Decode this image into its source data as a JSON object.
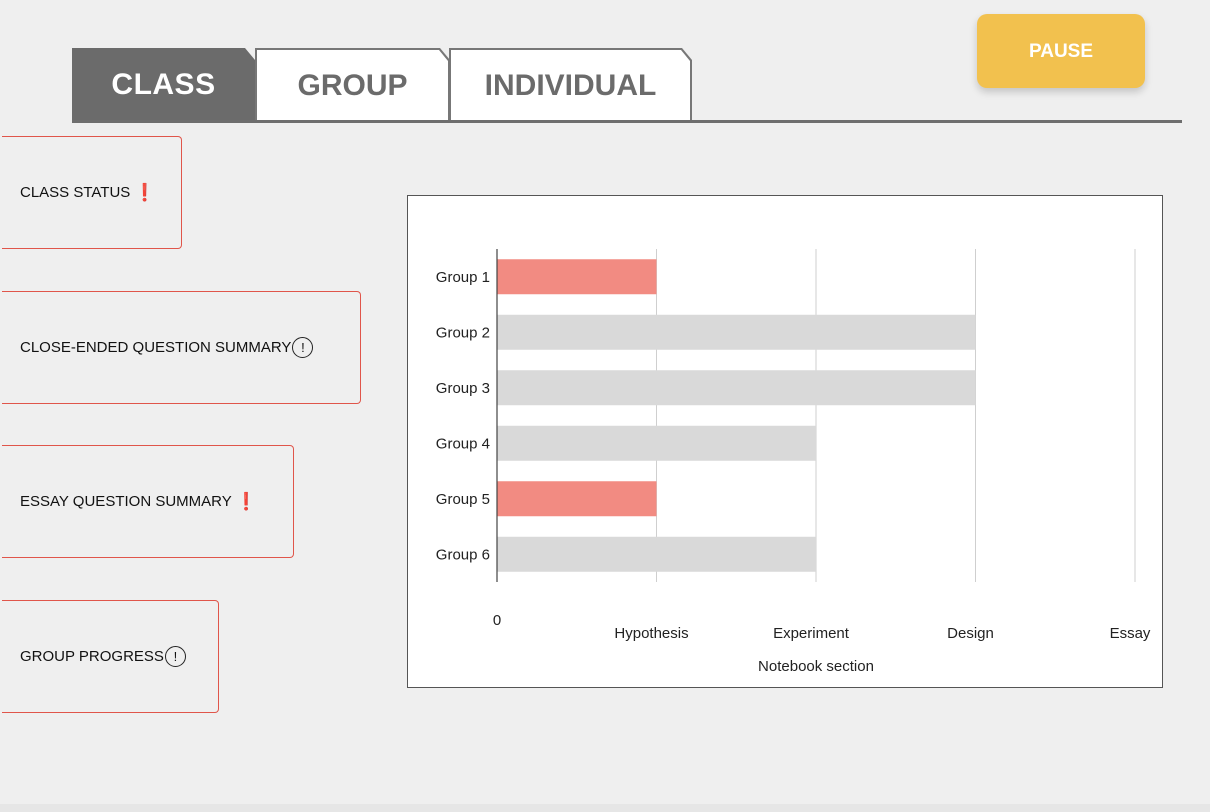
{
  "tabs": [
    {
      "label": "CLASS",
      "active": true
    },
    {
      "label": "GROUP",
      "active": false
    },
    {
      "label": "INDIVIDUAL",
      "active": false
    }
  ],
  "pause_button": {
    "label": "PAUSE",
    "color": "#f2c14e"
  },
  "panels": [
    {
      "label": "CLASS STATUS",
      "icon": "exclamation-icon",
      "icon_glyph": "❗"
    },
    {
      "label": "CLOSE-ENDED QUESTION SUMMARY",
      "icon": "circled-exclamation-icon",
      "icon_glyph": "!"
    },
    {
      "label": "ESSAY QUESTION SUMMARY",
      "icon": "exclamation-icon",
      "icon_glyph": "❗"
    },
    {
      "label": "GROUP PROGRESS",
      "icon": "circled-exclamation-icon",
      "icon_glyph": "!"
    }
  ],
  "colors": {
    "accent_alert": "#f28b82",
    "bar_default": "#d9d9d9",
    "panel_border": "#e0554a"
  },
  "chart_data": {
    "type": "bar",
    "orientation": "horizontal",
    "categories": [
      "Group 1",
      "Group 2",
      "Group 3",
      "Group 4",
      "Group 5",
      "Group 6"
    ],
    "x_tick_labels": [
      "0",
      "Hypothesis",
      "Experiment",
      "Design",
      "Essay"
    ],
    "values": [
      1,
      3,
      3,
      2,
      1,
      2
    ],
    "highlight": [
      true,
      false,
      false,
      false,
      true,
      false
    ],
    "xlabel": "Notebook section",
    "ylabel": "",
    "xlim": [
      0,
      4
    ],
    "grid": true
  }
}
